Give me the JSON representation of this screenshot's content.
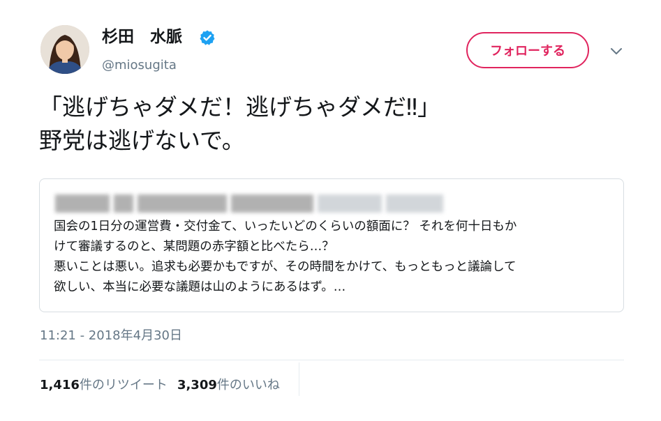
{
  "author": {
    "display_name": "杉田　水脈",
    "username": "@miosugita",
    "verified_icon": "verified-badge-icon"
  },
  "follow_button": {
    "label": "フォローする"
  },
  "menu_icon": "chevron-down-icon",
  "tweet": {
    "lines": [
      "「逃げちゃダメだ！逃げちゃダメだ‼」",
      "野党は逃げないで。"
    ]
  },
  "quoted_tweet": {
    "header_blurred": true,
    "lines": [
      "国会の1日分の運営費・交付金て、いったいどのくらいの額面に？ それを何十日もか",
      "けて審議するのと、某問題の赤字額と比べたら…？",
      "悪いことは悪い。追求も必要かもですが、その時間をかけて、もっともっと議論して",
      "欲しい、本当に必要な議題は山のようにあるはず。…"
    ]
  },
  "timestamp": "11:21 - 2018年4月30日",
  "stats": {
    "retweets_count": "1,416",
    "retweets_label": "件のリツイート",
    "likes_count": "3,309",
    "likes_label": "件のいいね"
  },
  "colors": {
    "follow_accent": "#e0245e",
    "verified_blue": "#1da1f2",
    "secondary_text": "#657786",
    "border": "#e6ecf0"
  }
}
